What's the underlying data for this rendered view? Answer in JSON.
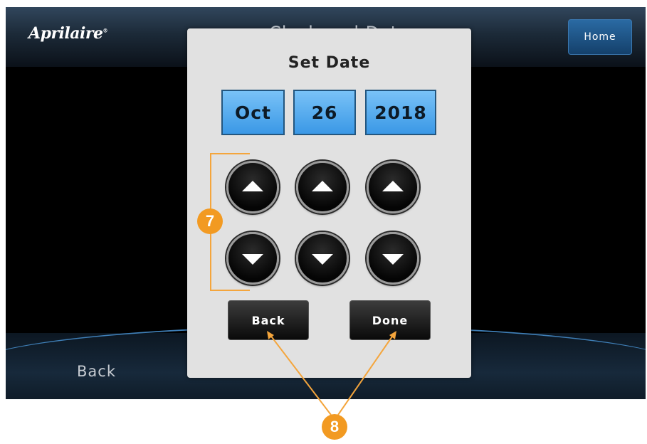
{
  "header": {
    "logo": "Aprilaire",
    "logo_mark": "®",
    "title": "Clock and Date",
    "home_label": "Home"
  },
  "footer": {
    "back_label": "Back"
  },
  "dialog": {
    "title": "Set Date",
    "fields": {
      "month": "Oct",
      "day": "26",
      "year": "2018"
    },
    "back_label": "Back",
    "done_label": "Done"
  },
  "callouts": {
    "arrows": "7",
    "buttons": "8"
  },
  "colors": {
    "field_blue": "#4ea8ee",
    "callout_orange": "#f29a22",
    "home_blue": "#1d5487"
  }
}
